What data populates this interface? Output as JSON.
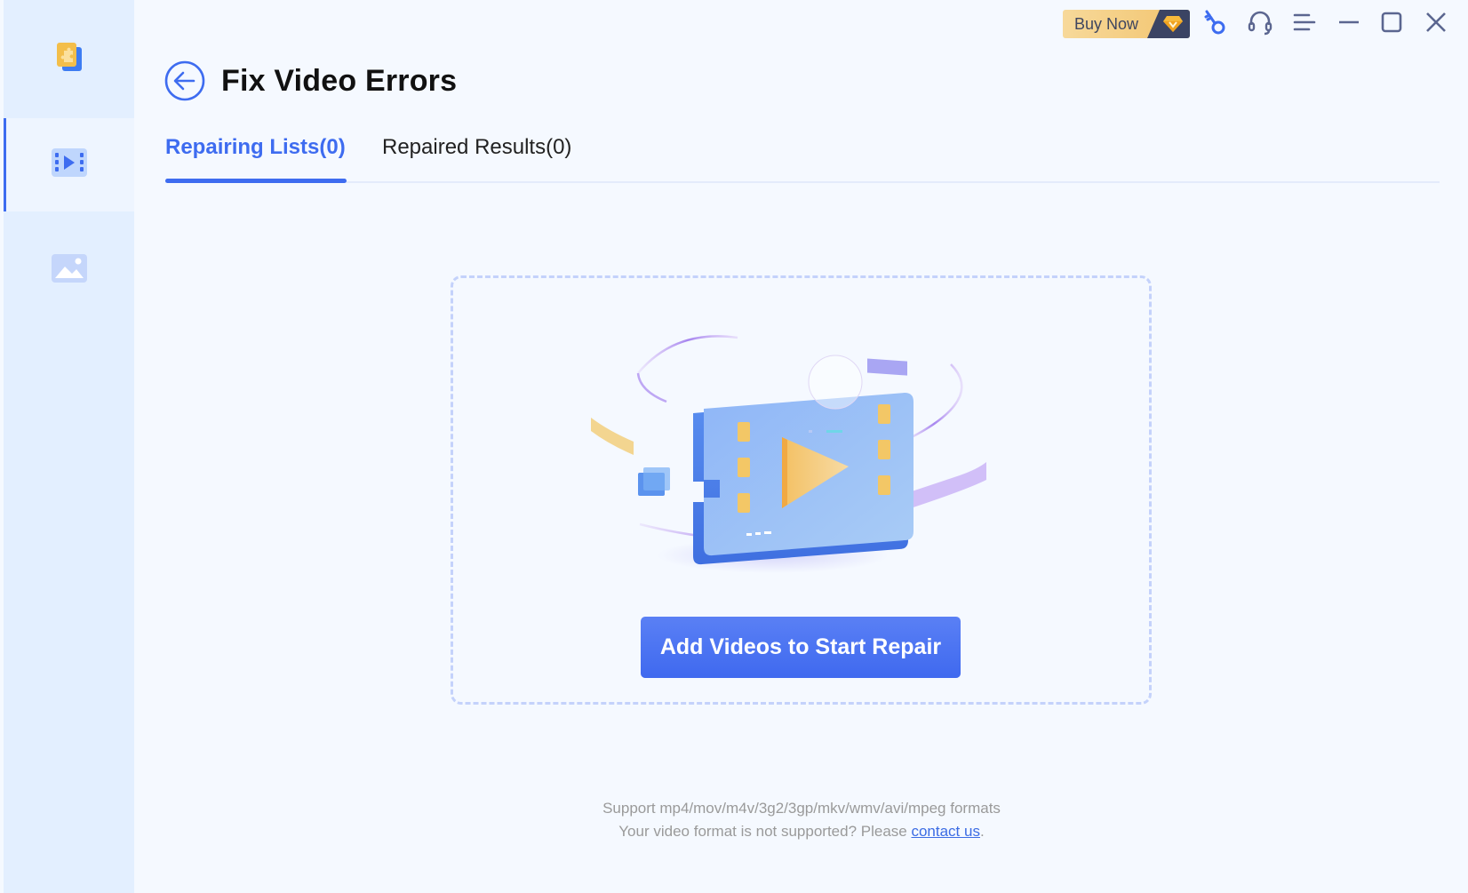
{
  "sidebar": {
    "items": [
      {
        "name": "toolbox",
        "icon": "puzzle-app-icon",
        "active": false
      },
      {
        "name": "video-repair",
        "icon": "video-film-icon",
        "active": true
      },
      {
        "name": "photo-repair",
        "icon": "image-icon",
        "active": false
      }
    ]
  },
  "titlebar": {
    "buy_now_label": "Buy Now",
    "icons": [
      "diamond-icon",
      "key-icon",
      "headset-icon",
      "menu-icon",
      "minimize-icon",
      "maximize-icon",
      "close-icon"
    ]
  },
  "header": {
    "title": "Fix Video Errors",
    "back_icon": "back-arrow-icon"
  },
  "tabs": [
    {
      "label": "Repairing Lists(0)",
      "active": true
    },
    {
      "label": "Repaired Results(0)",
      "active": false
    }
  ],
  "dropzone": {
    "button_label": "Add Videos to Start Repair"
  },
  "footer": {
    "formats_text": "Support mp4/mov/m4v/3g2/3gp/mkv/wmv/avi/mpeg formats",
    "unsupported_prefix": "Your video format is not supported? Please ",
    "contact_link": "contact us",
    "unsupported_suffix": "."
  },
  "colors": {
    "accent": "#3e6cf0",
    "background": "#f5f9ff",
    "sidebar": "#e3efff",
    "buy_now_gold": "#f2c46e",
    "dashed_border": "#c4d2fb"
  }
}
